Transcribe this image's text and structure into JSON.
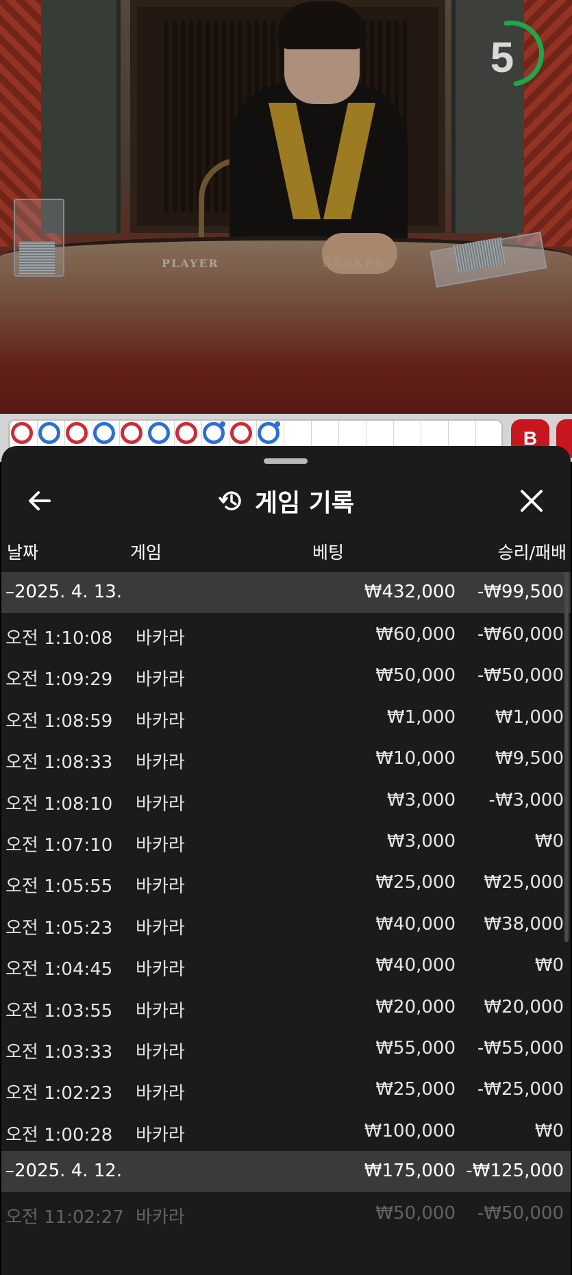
{
  "video": {
    "timer": "5",
    "table_label_left": "PLAYER",
    "table_label_right": "BANKER"
  },
  "roadmap": {
    "beads": [
      "r",
      "b",
      "r",
      "b",
      "r",
      "b",
      "r",
      "b",
      "r",
      "b"
    ],
    "button": "B"
  },
  "sheet": {
    "title": "게임 기록",
    "columns": {
      "date": "날짜",
      "game": "게임",
      "bet": "베팅",
      "result": "승리/패배"
    },
    "groups": [
      {
        "date": "–2025. 4. 13.",
        "bet": "₩432,000",
        "result": "-₩99,500",
        "rows": [
          {
            "time": "오전 1:10:08",
            "game": "바카라",
            "bet": "₩60,000",
            "result": "-₩60,000"
          },
          {
            "time": "오전 1:09:29",
            "game": "바카라",
            "bet": "₩50,000",
            "result": "-₩50,000"
          },
          {
            "time": "오전 1:08:59",
            "game": "바카라",
            "bet": "₩1,000",
            "result": "₩1,000"
          },
          {
            "time": "오전 1:08:33",
            "game": "바카라",
            "bet": "₩10,000",
            "result": "₩9,500"
          },
          {
            "time": "오전 1:08:10",
            "game": "바카라",
            "bet": "₩3,000",
            "result": "-₩3,000"
          },
          {
            "time": "오전 1:07:10",
            "game": "바카라",
            "bet": "₩3,000",
            "result": "₩0"
          },
          {
            "time": "오전 1:05:55",
            "game": "바카라",
            "bet": "₩25,000",
            "result": "₩25,000"
          },
          {
            "time": "오전 1:05:23",
            "game": "바카라",
            "bet": "₩40,000",
            "result": "₩38,000"
          },
          {
            "time": "오전 1:04:45",
            "game": "바카라",
            "bet": "₩40,000",
            "result": "₩0"
          },
          {
            "time": "오전 1:03:55",
            "game": "바카라",
            "bet": "₩20,000",
            "result": "₩20,000"
          },
          {
            "time": "오전 1:03:33",
            "game": "바카라",
            "bet": "₩55,000",
            "result": "-₩55,000"
          },
          {
            "time": "오전 1:02:23",
            "game": "바카라",
            "bet": "₩25,000",
            "result": "-₩25,000"
          },
          {
            "time": "오전 1:00:28",
            "game": "바카라",
            "bet": "₩100,000",
            "result": "₩0"
          }
        ]
      },
      {
        "date": "–2025. 4. 12.",
        "bet": "₩175,000",
        "result": "-₩125,000",
        "rows": [
          {
            "time": "오전 11:02:27",
            "game": "바카라",
            "bet": "₩50,000",
            "result": "-₩50,000"
          }
        ]
      }
    ]
  }
}
